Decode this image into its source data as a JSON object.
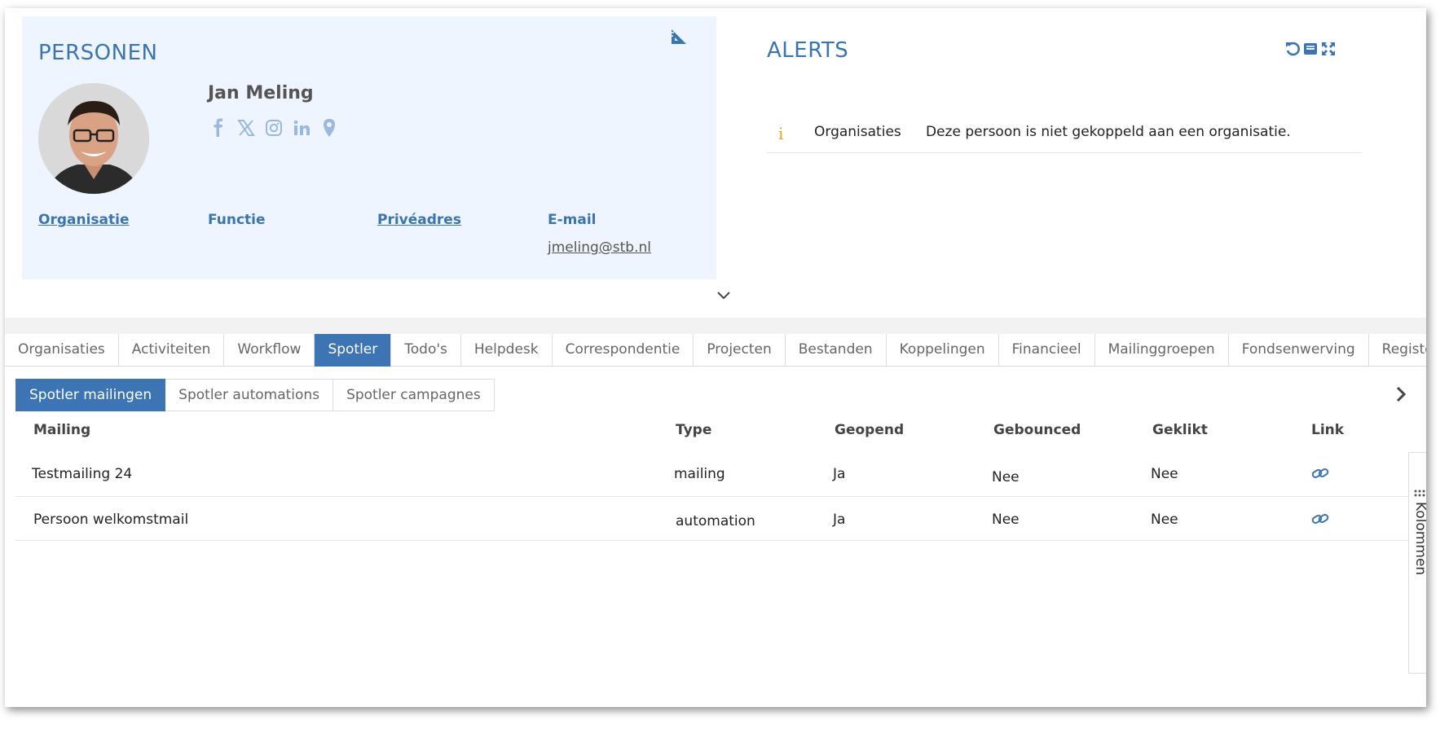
{
  "person_card": {
    "title": "PERSONEN",
    "name": "Jan Meling",
    "fields": {
      "organisatie": "Organisatie",
      "functie": "Functie",
      "priveadres": "Privéadres",
      "email_label": "E-mail",
      "email_value": "jmeling@stb.nl"
    },
    "social_icons": [
      "facebook-icon",
      "x-icon",
      "instagram-icon",
      "linkedin-icon",
      "map-pin-icon"
    ]
  },
  "alerts": {
    "title": "ALERTS",
    "items": [
      {
        "icon": "info-icon",
        "category": "Organisaties",
        "message": "Deze persoon is niet gekoppeld aan een organisatie."
      }
    ]
  },
  "tabs": [
    {
      "label": "Organisaties",
      "active": false
    },
    {
      "label": "Activiteiten",
      "active": false
    },
    {
      "label": "Workflow",
      "active": false
    },
    {
      "label": "Spotler",
      "active": true
    },
    {
      "label": "Todo's",
      "active": false
    },
    {
      "label": "Helpdesk",
      "active": false
    },
    {
      "label": "Correspondentie",
      "active": false
    },
    {
      "label": "Projecten",
      "active": false
    },
    {
      "label": "Bestanden",
      "active": false
    },
    {
      "label": "Koppelingen",
      "active": false
    },
    {
      "label": "Financieel",
      "active": false
    },
    {
      "label": "Mailinggroepen",
      "active": false
    },
    {
      "label": "Fondsenwerving",
      "active": false
    },
    {
      "label": "Registers",
      "active": false
    }
  ],
  "subtabs": [
    {
      "label": "Spotler mailingen",
      "active": true
    },
    {
      "label": "Spotler automations",
      "active": false
    },
    {
      "label": "Spotler campagnes",
      "active": false
    }
  ],
  "table": {
    "columns": [
      "Mailing",
      "Type",
      "Geopend",
      "Gebounced",
      "Geklikt",
      "Link"
    ],
    "rows": [
      {
        "mailing": "Testmailing 24",
        "type": "mailing",
        "geopend": "Ja",
        "gebounced": "Nee",
        "geklikt": "Nee"
      },
      {
        "mailing": "Persoon welkomstmail",
        "type": "automation",
        "geopend": "Ja",
        "gebounced": "Nee",
        "geklikt": "Nee"
      }
    ]
  },
  "side_panel": {
    "label": "Kolommen"
  },
  "colors": {
    "accent": "#3d74b3",
    "title_blue": "#3a75b0",
    "card_bg": "#eef5fe",
    "info": "#e8a317"
  }
}
